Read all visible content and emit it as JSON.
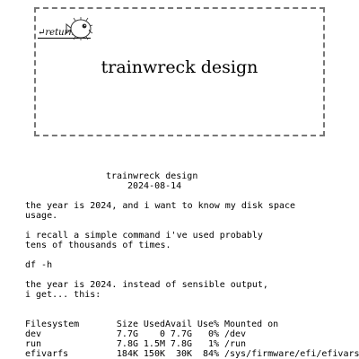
{
  "header": {
    "return_label": "↵return",
    "site_title": "trainwreck design"
  },
  "post": {
    "title": "trainwreck design",
    "date": "2024-08-14",
    "paragraphs": [
      "the year is 2024, and i want to know my disk space\nusage.",
      "i recall a simple command i've used probably\ntens of thousands of times.",
      "df -h",
      "the year is 2024. instead of sensible output,\ni get... this:"
    ]
  },
  "df_table": {
    "headers": [
      "Filesystem",
      "Size",
      "Used",
      "Avail",
      "Use%",
      "Mounted on"
    ],
    "rows": [
      [
        "dev",
        "7.7G",
        "0",
        "7.7G",
        "0%",
        "/dev"
      ],
      [
        "run",
        "7.8G",
        "1.5M",
        "7.8G",
        "1%",
        "/run"
      ],
      [
        "efivarfs",
        "184K",
        "150K",
        "30K",
        "84%",
        "/sys/firmware/efi/efivars"
      ]
    ]
  }
}
